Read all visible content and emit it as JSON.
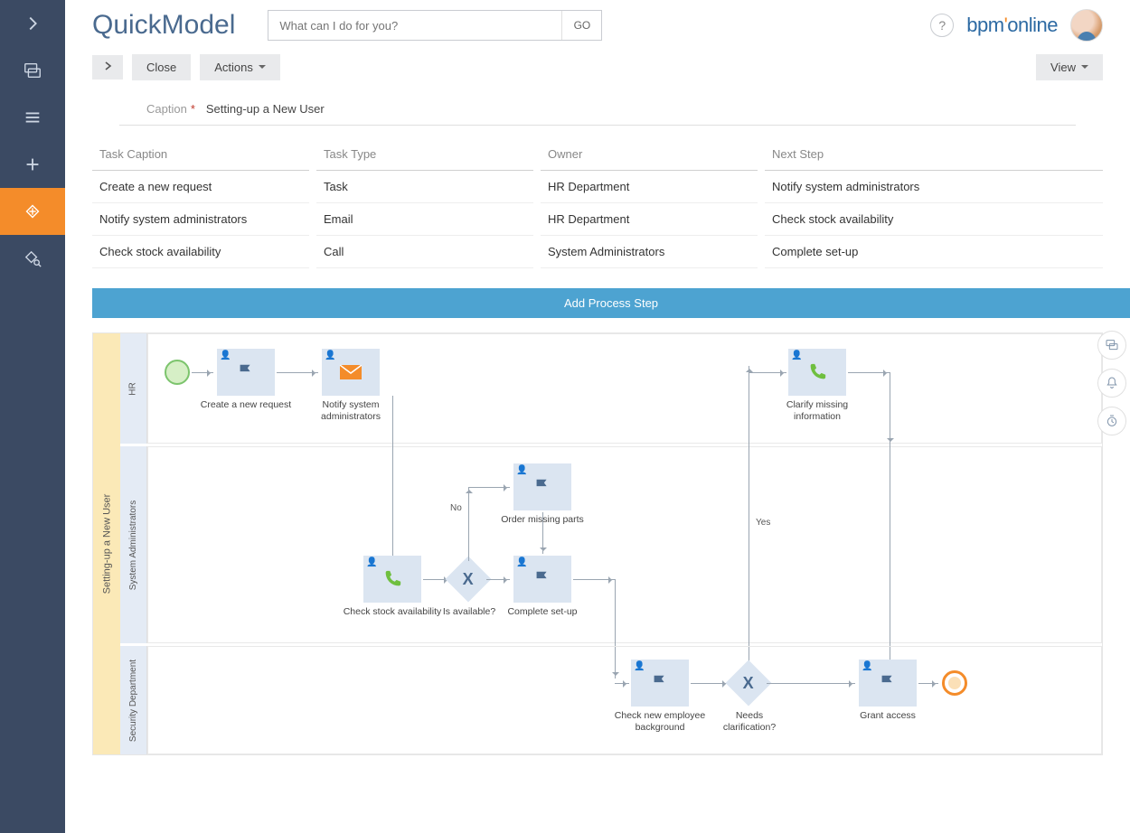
{
  "app": {
    "title": "QuickModel"
  },
  "brand": {
    "text1": "bpm",
    "accent": "'",
    "text2": "online"
  },
  "search": {
    "placeholder": "What can I do for you?",
    "go": "GO"
  },
  "toolbar": {
    "close": "Close",
    "actions": "Actions",
    "view": "View"
  },
  "caption": {
    "label": "Caption",
    "value": "Setting-up a New User"
  },
  "columns": {
    "c1": "Task Caption",
    "c2": "Task Type",
    "c3": "Owner",
    "c4": "Next Step"
  },
  "rows": [
    {
      "c1": "Create a new request",
      "c2": "Task",
      "c3": "HR Department",
      "c4": "Notify system administrators"
    },
    {
      "c1": "Notify system administrators",
      "c2": "Email",
      "c3": "HR Department",
      "c4": "Check stock availability"
    },
    {
      "c1": "Check stock availability",
      "c2": "Call",
      "c3": "System Administrators",
      "c4": "Complete set-up"
    }
  ],
  "addStep": "Add Process Step",
  "pool": {
    "title": "Setting-up a New User"
  },
  "lanes": {
    "l1": "HR",
    "l2": "System Administrators",
    "l3": "Security Department"
  },
  "nodes": {
    "n1": "Create a new request",
    "n2": "Notify system administrators",
    "n3": "Check stock availability",
    "n4": "Order missing parts",
    "n5": "Complete set-up",
    "n6": "Clarify missing information",
    "n7": "Check new employee background",
    "n8": "Grant access",
    "g1": "Is available?",
    "g2": "Needs clarification?"
  },
  "edgeLabels": {
    "no": "No",
    "yes": "Yes"
  }
}
